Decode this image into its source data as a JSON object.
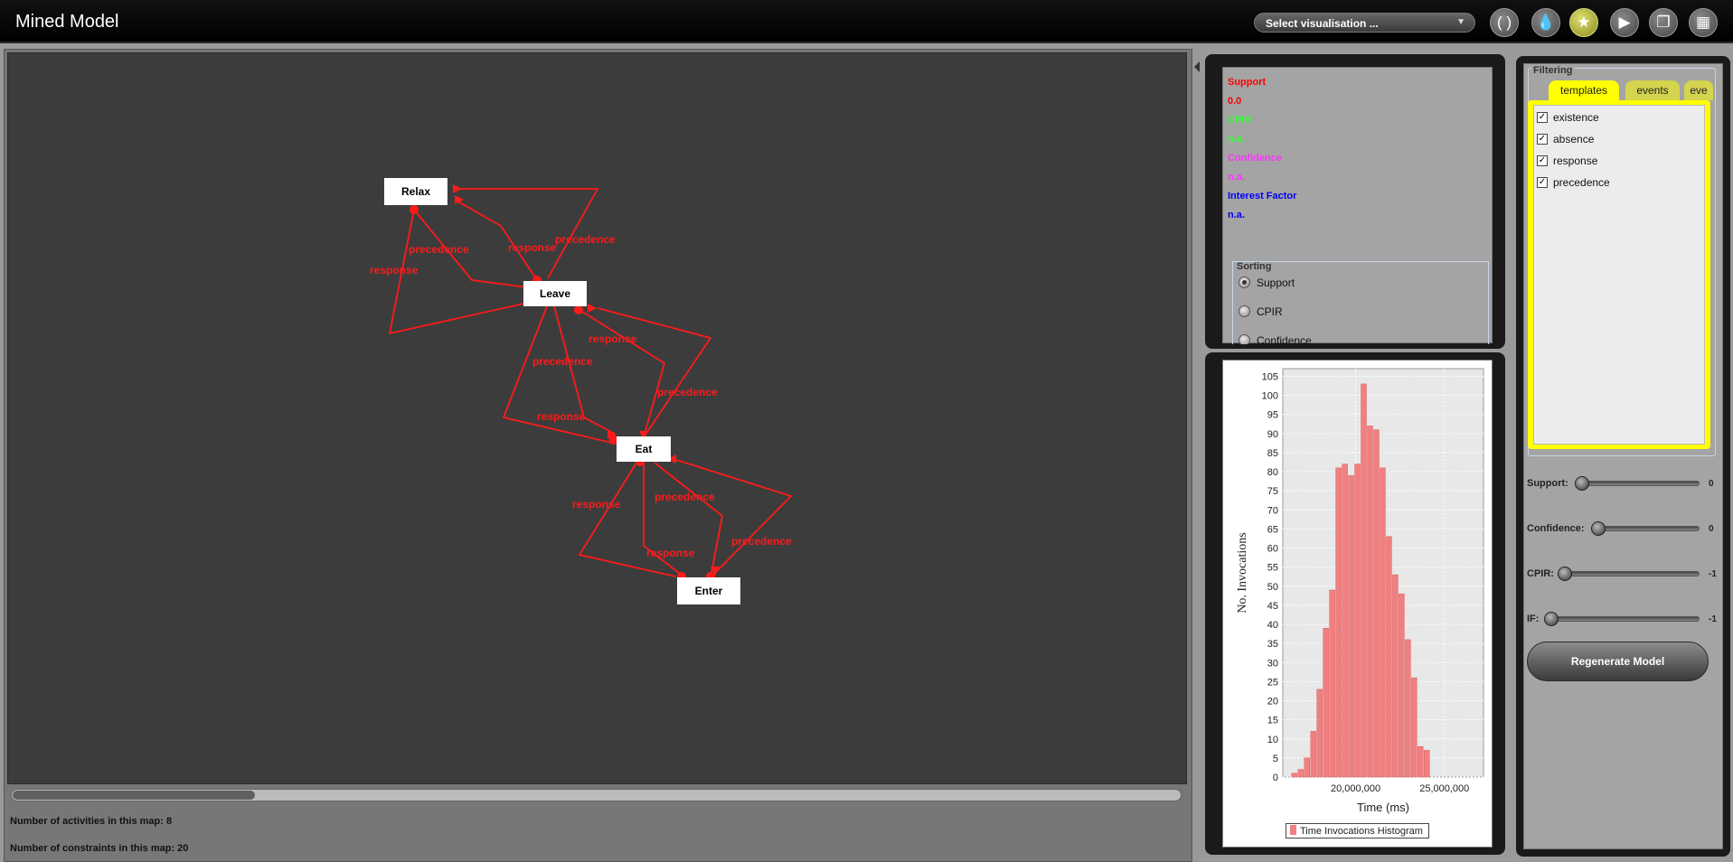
{
  "app": {
    "title": "Mined Model"
  },
  "toolbar": {
    "visualisation_select": "Select visualisation ...",
    "icons": [
      "bracket-icon",
      "drop-icon",
      "star-icon",
      "play-icon",
      "copy-icon",
      "grid-icon"
    ]
  },
  "graph": {
    "nodes": [
      {
        "id": "relax",
        "label": "Relax"
      },
      {
        "id": "leave",
        "label": "Leave"
      },
      {
        "id": "eat",
        "label": "Eat"
      },
      {
        "id": "enter",
        "label": "Enter"
      }
    ],
    "edge_labels": {
      "relax_leave_precedence": "precedence",
      "relax_leave_response_left": "response",
      "leave_relax_response": "response",
      "leave_relax_precedence": "precedence",
      "leave_eat_response": "response",
      "leave_eat_precedence": "precedence",
      "eat_leave_precedence": "precedence",
      "eat_leave_response": "response",
      "eat_enter_response": "response",
      "eat_enter_precedence": "precedence",
      "enter_eat_response": "response",
      "enter_eat_precedence": "precedence"
    },
    "edge_color": "#ff1a1a"
  },
  "status": {
    "activities": "Number of activities in this map: 8",
    "constraints": "Number of constraints in this map: 20"
  },
  "info": {
    "support_label": "Support",
    "support_value": "0.0",
    "cpir_label": "CPIR",
    "cpir_value": "n.a.",
    "confidence_label": "Confidence",
    "confidence_value": "n.a.",
    "if_label": "Interest Factor",
    "if_value": "n.a.",
    "colors": {
      "support": "#ff0000",
      "cpir": "#33ff33",
      "confidence": "#ff33ff",
      "if": "#0000ff"
    }
  },
  "sorting": {
    "title": "Sorting",
    "options": [
      "Support",
      "CPIR",
      "Confidence"
    ],
    "selected": "Support"
  },
  "histogram": {
    "legend": "Time Invocations Histogram",
    "xlabel": "Time (ms)",
    "ylabel": "No. Invocations",
    "xticks": [
      "20,000,000",
      "25,000,000"
    ],
    "yticks": [
      "0",
      "5",
      "10",
      "15",
      "20",
      "25",
      "30",
      "35",
      "40",
      "45",
      "50",
      "55",
      "60",
      "65",
      "70",
      "75",
      "80",
      "85",
      "90",
      "95",
      "100",
      "105"
    ]
  },
  "chart_data": {
    "type": "bar",
    "title": "",
    "xlabel": "Time (ms)",
    "ylabel": "No. Invocations",
    "ylim": [
      0,
      107
    ],
    "xlim": [
      15900000,
      27200000
    ],
    "bin_width": 355000,
    "x": [
      16400000,
      16755000,
      17110000,
      17465000,
      17820000,
      18175000,
      18530000,
      18885000,
      19240000,
      19595000,
      19950000,
      20305000,
      20660000,
      21015000,
      21370000,
      21725000,
      22080000,
      22435000,
      22790000,
      23145000,
      23500000,
      23855000,
      24210000,
      24565000,
      24920000,
      25275000,
      25630000,
      25985000,
      26340000
    ],
    "values": [
      1,
      2,
      5,
      12,
      23,
      39,
      49,
      81,
      82,
      79,
      82,
      103,
      92,
      91,
      81,
      63,
      53,
      48,
      36,
      26,
      8,
      7,
      0,
      0,
      0,
      0,
      0,
      0,
      0
    ],
    "series": [
      {
        "name": "Time Invocations Histogram",
        "color": "#f08080"
      }
    ]
  },
  "filtering": {
    "title": "Filtering",
    "tabs": [
      "templates",
      "events",
      "eve"
    ],
    "active_tab": "templates",
    "templates": [
      {
        "label": "existence",
        "checked": true
      },
      {
        "label": "absence",
        "checked": true
      },
      {
        "label": "response",
        "checked": true
      },
      {
        "label": "precedence",
        "checked": true
      }
    ],
    "sliders": [
      {
        "label": "Support:",
        "value": "0",
        "level": 0
      },
      {
        "label": "Confidence:",
        "value": "0",
        "level": 0
      },
      {
        "label": "CPIR:",
        "value": "-1",
        "level": 0
      },
      {
        "label": "IF:",
        "value": "-1",
        "level": 0
      }
    ],
    "regenerate_label": "Regenerate Model"
  }
}
